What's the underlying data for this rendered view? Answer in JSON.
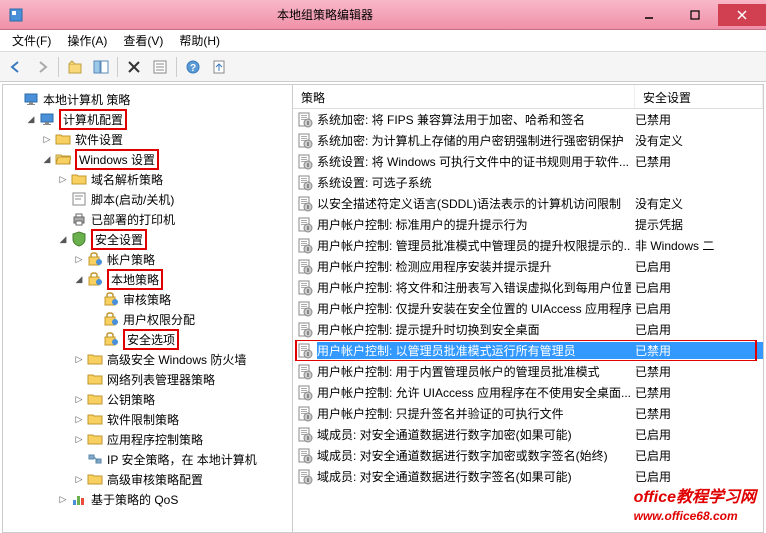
{
  "window": {
    "title": "本地组策略编辑器"
  },
  "menu": {
    "file": "文件(F)",
    "action": "操作(A)",
    "view": "查看(V)",
    "help": "帮助(H)"
  },
  "tree": {
    "root": "本地计算机 策略",
    "computer_config": "计算机配置",
    "software_settings": "软件设置",
    "windows_settings": "Windows 设置",
    "dns_policy": "域名解析策略",
    "scripts": "脚本(启动/关机)",
    "deployed_printers": "已部署的打印机",
    "security_settings": "安全设置",
    "account_policies": "帐户策略",
    "local_policies": "本地策略",
    "audit_policy": "审核策略",
    "user_rights": "用户权限分配",
    "security_options": "安全选项",
    "advanced_firewall": "高级安全 Windows 防火墙",
    "network_list": "网络列表管理器策略",
    "public_key": "公钥策略",
    "software_restriction": "软件限制策略",
    "app_control": "应用程序控制策略",
    "ip_security": "IP 安全策略，在 本地计算机",
    "advanced_audit": "高级审核策略配置",
    "policy_qos": "基于策略的 QoS"
  },
  "list": {
    "header_policy": "策略",
    "header_setting": "安全设置",
    "rows": [
      {
        "policy": "系统加密: 将 FIPS 兼容算法用于加密、哈希和签名",
        "setting": "已禁用"
      },
      {
        "policy": "系统加密: 为计算机上存储的用户密钥强制进行强密钥保护",
        "setting": "没有定义"
      },
      {
        "policy": "系统设置: 将 Windows 可执行文件中的证书规则用于软件...",
        "setting": "已禁用"
      },
      {
        "policy": "系统设置: 可选子系统",
        "setting": ""
      },
      {
        "policy": "以安全描述符定义语言(SDDL)语法表示的计算机访问限制",
        "setting": "没有定义"
      },
      {
        "policy": "用户帐户控制: 标准用户的提升提示行为",
        "setting": "提示凭据"
      },
      {
        "policy": "用户帐户控制: 管理员批准模式中管理员的提升权限提示的...",
        "setting": "非 Windows 二"
      },
      {
        "policy": "用户帐户控制: 检测应用程序安装并提示提升",
        "setting": "已启用"
      },
      {
        "policy": "用户帐户控制: 将文件和注册表写入错误虚拟化到每用户位置",
        "setting": "已启用"
      },
      {
        "policy": "用户帐户控制: 仅提升安装在安全位置的 UIAccess 应用程序",
        "setting": "已启用"
      },
      {
        "policy": "用户帐户控制: 提示提升时切换到安全桌面",
        "setting": "已启用"
      },
      {
        "policy": "用户帐户控制: 以管理员批准模式运行所有管理员",
        "setting": "已禁用",
        "selected": true
      },
      {
        "policy": "用户帐户控制: 用于内置管理员帐户的管理员批准模式",
        "setting": "已禁用"
      },
      {
        "policy": "用户帐户控制: 允许 UIAccess 应用程序在不使用安全桌面...",
        "setting": "已禁用"
      },
      {
        "policy": "用户帐户控制: 只提升签名并验证的可执行文件",
        "setting": "已禁用"
      },
      {
        "policy": "域成员: 对安全通道数据进行数字加密(如果可能)",
        "setting": "已启用"
      },
      {
        "policy": "域成员: 对安全通道数据进行数字加密或数字签名(始终)",
        "setting": "已启用"
      },
      {
        "policy": "域成员: 对安全通道数据进行数字签名(如果可能)",
        "setting": "已启用"
      }
    ]
  },
  "watermark": "office教程学习网",
  "watermark_sub": "www.office68.com"
}
